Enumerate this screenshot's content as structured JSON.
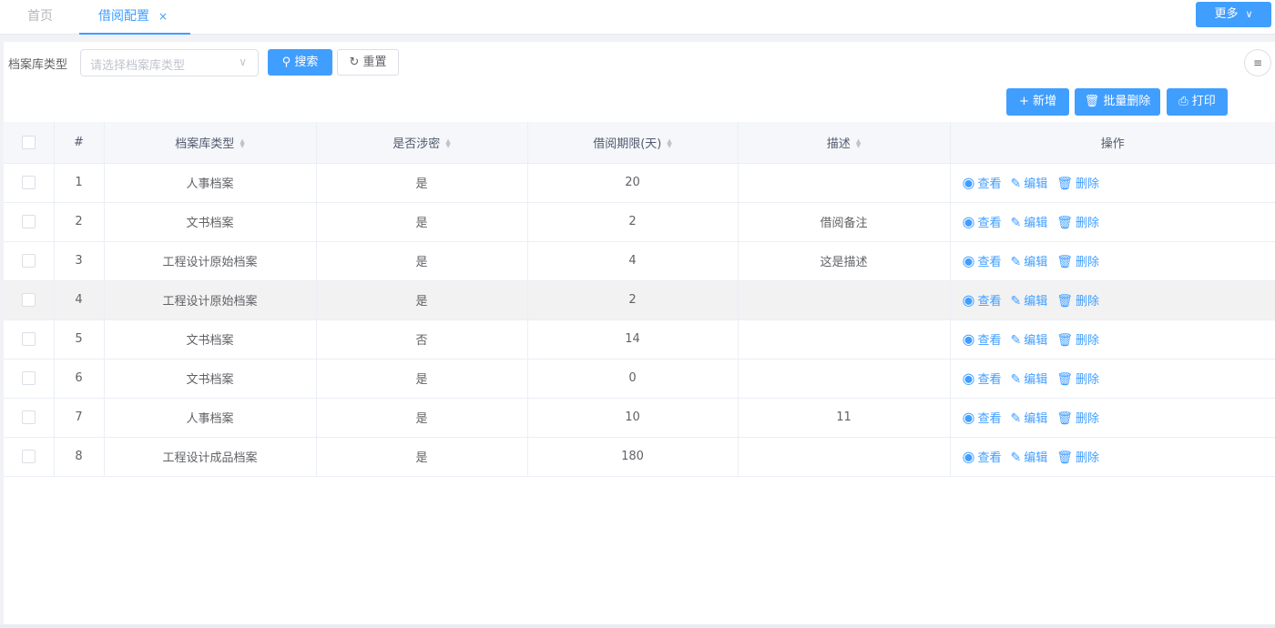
{
  "tabs": {
    "home": "首页",
    "active": "借阅配置",
    "close_icon": "×",
    "more_label": "更多"
  },
  "filter": {
    "label": "档案库类型",
    "placeholder": "请选择档案库类型",
    "search_label": "搜索",
    "reset_label": "重置"
  },
  "actions": {
    "add_label": "新增",
    "batch_delete_label": "批量删除",
    "print_label": "打印"
  },
  "table": {
    "headers": {
      "index": "#",
      "type": "档案库类型",
      "secret": "是否涉密",
      "period": "借阅期限(天)",
      "desc": "描述",
      "ops": "操作"
    },
    "op_labels": {
      "view": "查看",
      "edit": "编辑",
      "delete": "删除"
    },
    "rows": [
      {
        "index": "1",
        "type": "人事档案",
        "secret": "是",
        "period": "20",
        "desc": ""
      },
      {
        "index": "2",
        "type": "文书档案",
        "secret": "是",
        "period": "2",
        "desc": "借阅备注"
      },
      {
        "index": "3",
        "type": "工程设计原始档案",
        "secret": "是",
        "period": "4",
        "desc": "这是描述"
      },
      {
        "index": "4",
        "type": "工程设计原始档案",
        "secret": "是",
        "period": "2",
        "desc": ""
      },
      {
        "index": "5",
        "type": "文书档案",
        "secret": "否",
        "period": "14",
        "desc": ""
      },
      {
        "index": "6",
        "type": "文书档案",
        "secret": "是",
        "period": "0",
        "desc": ""
      },
      {
        "index": "7",
        "type": "人事档案",
        "secret": "是",
        "period": "10",
        "desc": "11"
      },
      {
        "index": "8",
        "type": "工程设计成品档案",
        "secret": "是",
        "period": "180",
        "desc": ""
      }
    ]
  },
  "theme": {
    "accent": "#409eff",
    "highlight_row": "#f2f2f2"
  }
}
